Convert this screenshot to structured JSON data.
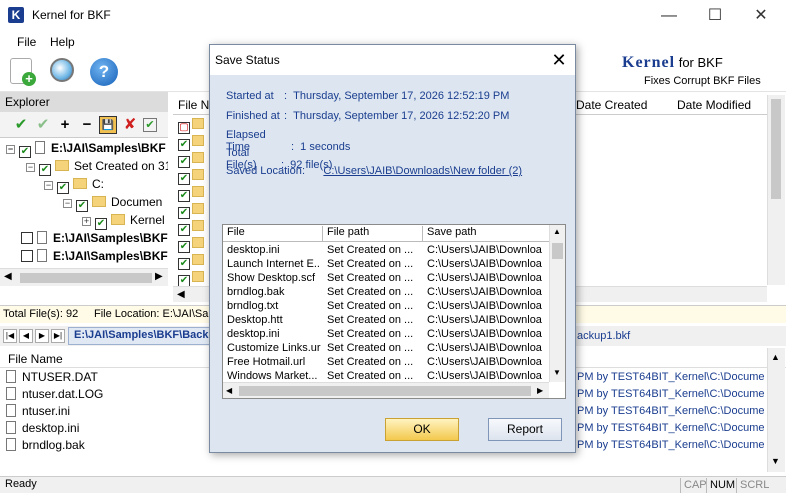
{
  "window": {
    "title": "Kernel for BKF",
    "icon_letter": "K"
  },
  "menu": [
    "File",
    "Help"
  ],
  "toolbar": {
    "icons": [
      "add-icon",
      "search-icon",
      "help-icon"
    ]
  },
  "brand": {
    "name": "Kernel",
    "suffix": " for BKF",
    "tagline": "Fixes Corrupt BKF Files"
  },
  "explorer": {
    "title": "Explorer",
    "tree": [
      "E:\\JAI\\Samples\\BKF",
      "Set Created on 31",
      "C:",
      "Documen",
      "Kernel",
      "E:\\JAI\\Samples\\BKF",
      "E:\\JAI\\Samples\\BKF"
    ]
  },
  "filelist": {
    "columns": {
      "name": "File Na",
      "date_created": "Date Created",
      "date_modified": "Date Modified"
    }
  },
  "status_info": {
    "total_files": "Total File(s): 92",
    "file_location": "File Location: E:\\JAI\\Sa"
  },
  "path_bar": {
    "path": "E:\\JAI\\Samples\\BKF\\Backu",
    "path_right": "ackup1.bkf"
  },
  "bottom_list": {
    "column": "File Name",
    "rows": [
      "NTUSER.DAT",
      "ntuser.dat.LOG",
      "ntuser.ini",
      "desktop.ini",
      "brndlog.bak"
    ],
    "right_text": "PM by TEST64BIT_Kernel\\C:\\Documen"
  },
  "statusbar": {
    "ready": "Ready",
    "cap": "CAP",
    "num": "NUM",
    "scrl": "SCRL"
  },
  "dialog": {
    "title": "Save Status",
    "started_label": "Started at",
    "started_value": "Thursday, September 17, 2026 12:52:19 PM",
    "finished_label": "Finished at",
    "finished_value": "Thursday, September 17, 2026 12:52:20 PM",
    "elapsed_label": "Elapsed Time",
    "elapsed_value": "1 seconds",
    "total_label": "Total File(s)",
    "total_value": "92 file(s)",
    "location_label": "Saved Location",
    "location_value": "C:\\Users\\JAIB\\Downloads\\New folder (2)",
    "table": {
      "headers": [
        "File",
        "File path",
        "Save path"
      ],
      "rows": [
        [
          "desktop.ini",
          "Set Created on ...",
          "C:\\Users\\JAIB\\Downloa"
        ],
        [
          "Launch Internet E...",
          "Set Created on ...",
          "C:\\Users\\JAIB\\Downloa"
        ],
        [
          "Show Desktop.scf",
          "Set Created on ...",
          "C:\\Users\\JAIB\\Downloa"
        ],
        [
          "brndlog.bak",
          "Set Created on ...",
          "C:\\Users\\JAIB\\Downloa"
        ],
        [
          "brndlog.txt",
          "Set Created on ...",
          "C:\\Users\\JAIB\\Downloa"
        ],
        [
          "Desktop.htt",
          "Set Created on ...",
          "C:\\Users\\JAIB\\Downloa"
        ],
        [
          "desktop.ini",
          "Set Created on ...",
          "C:\\Users\\JAIB\\Downloa"
        ],
        [
          "Customize Links.url",
          "Set Created on ...",
          "C:\\Users\\JAIB\\Downloa"
        ],
        [
          "Free Hotmail.url",
          "Set Created on ...",
          "C:\\Users\\JAIB\\Downloa"
        ],
        [
          "Windows Market...",
          "Set Created on ...",
          "C:\\Users\\JAIB\\Downloa"
        ]
      ]
    },
    "ok_label": "OK",
    "report_label": "Report"
  }
}
